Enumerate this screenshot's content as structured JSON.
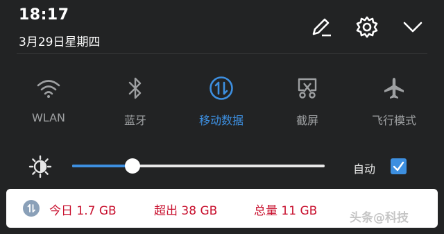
{
  "status": {
    "time": "18:17",
    "date": "3月29日星期四"
  },
  "header_actions": [
    {
      "icon": "edit-icon"
    },
    {
      "icon": "gear-icon"
    },
    {
      "icon": "chevron-down-icon"
    }
  ],
  "toggles": [
    {
      "label": "WLAN",
      "icon": "wifi-icon",
      "active": false
    },
    {
      "label": "蓝牙",
      "icon": "bluetooth-icon",
      "active": false
    },
    {
      "label": "移动数据",
      "icon": "mobile-data-icon",
      "active": true
    },
    {
      "label": "截屏",
      "icon": "screenshot-icon",
      "active": false
    },
    {
      "label": "飞行模式",
      "icon": "airplane-icon",
      "active": false
    }
  ],
  "brightness": {
    "level": 0.24,
    "auto_label": "自动",
    "auto_checked": true
  },
  "data_usage": {
    "today": "今日 1.7 GB",
    "exceeded": "超出 38 GB",
    "total": "总量 11 GB"
  },
  "watermark": "头条@科技",
  "colors": {
    "background": "#222324",
    "accent": "#3d8fe0",
    "inactive": "#9ea0a2",
    "usage_text": "#c8102e"
  }
}
